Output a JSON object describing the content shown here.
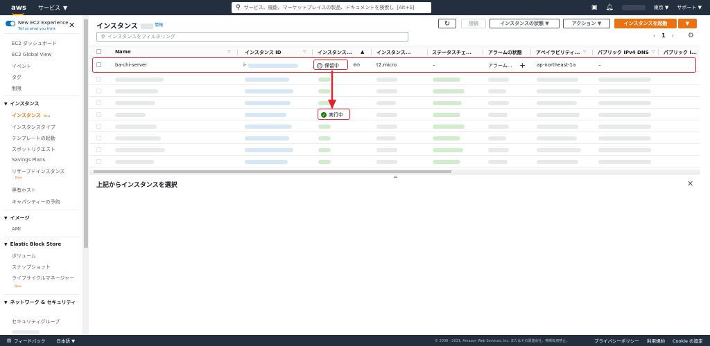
{
  "topbar": {
    "logo": "aws",
    "services": "サービス",
    "search_placeholder": "サービス、機能、マーケットプレイスの製品、ドキュメントを検索し",
    "search_shortcut": "[Alt+S]",
    "region": "東京",
    "support": "サポート"
  },
  "sidebar": {
    "new_experience": "New EC2 Experience",
    "new_experience_sub": "Tell us what you think",
    "items_top": [
      "EC2 ダッシュボード",
      "EC2 Global View",
      "イベント",
      "タグ",
      "制限"
    ],
    "section_instances": "インスタンス",
    "instances_items": [
      "インスタンス",
      "インスタンスタイプ",
      "テンプレートの起動",
      "スポットリクエスト",
      "Savings Plans",
      "リザーブドインスタンス",
      "専有ホスト",
      "キャパシティーの予約"
    ],
    "new_label": "New",
    "section_images": "イメージ",
    "images_items": [
      "AMI"
    ],
    "section_ebs": "Elastic Block Store",
    "ebs_items": [
      "ボリューム",
      "スナップショット",
      "ライフサイクルマネージャー"
    ],
    "section_network": "ネットワーク & セキュリティ",
    "network_items": [
      "セキュリティグループ"
    ]
  },
  "main": {
    "title": "インスタンス",
    "info": "情報",
    "buttons": {
      "refresh": "↻",
      "connect": "接続",
      "instance_state": "インスタンスの状態",
      "actions": "アクション",
      "launch": "インスタンスを起動"
    },
    "filter_placeholder": "インスタンスをフィルタリング",
    "page": "1",
    "columns": [
      "Name",
      "インスタンス ID",
      "インスタンス...",
      "インスタンス...",
      "ステータスチェ...",
      "アラームの状態",
      "アベイラビリティ...",
      "パブリック IPv4 DNS",
      "パブリック I..."
    ],
    "row": {
      "name": "ba-chi-server",
      "id_prefix": "i-",
      "state": "保留中",
      "type": "t2.micro",
      "status_check": "–",
      "alarm": "アラーム...",
      "alarm_add": "+",
      "az": "ap-northeast-1a",
      "dns": "–"
    },
    "callout_state": "実行中",
    "detail_title": "上記からインスタンスを選択",
    "split_handle": "="
  },
  "footer": {
    "feedback": "フィードバック",
    "language": "日本語",
    "copyright": "© 2008 - 2021, Amazon Web Services, Inc. またはその関連会社。無断転用禁止。",
    "privacy": "プライバシーポリシー",
    "terms": "利用規約",
    "cookie": "Cookie の設定"
  },
  "colors": {
    "nav_bg": "#232f3e",
    "accent": "#ec7211",
    "link": "#0073bb",
    "highlight": "#e0242d",
    "running": "#1d8102"
  }
}
